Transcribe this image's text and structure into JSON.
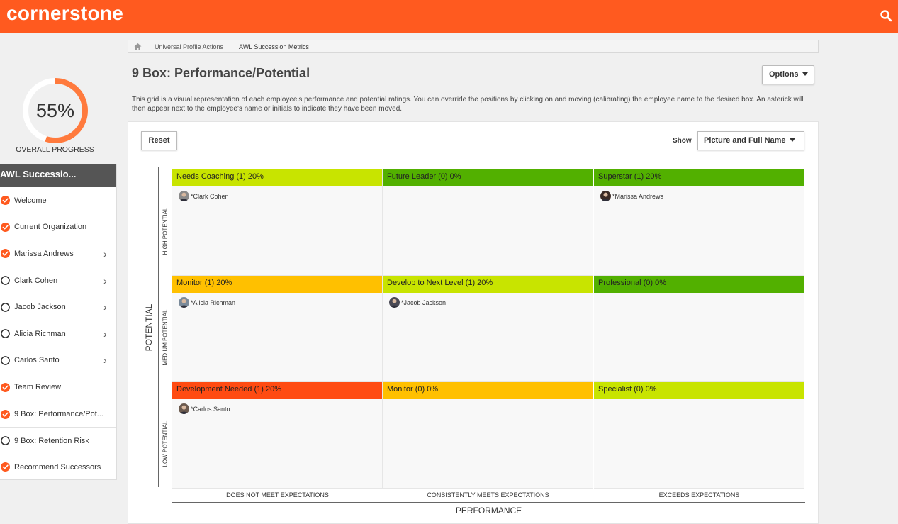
{
  "header": {
    "logo": "cornerstone"
  },
  "sidebar": {
    "progress_value": 55,
    "progress_text": "55%",
    "progress_label": "OVERALL PROGRESS",
    "menu_title": "AWL Successio...",
    "items": [
      {
        "label": "Welcome",
        "status": "complete",
        "chevron": false
      },
      {
        "label": "Current Organization",
        "status": "complete",
        "chevron": false
      },
      {
        "label": "Marissa Andrews",
        "status": "complete",
        "chevron": true
      },
      {
        "label": "Clark Cohen",
        "status": "incomplete",
        "chevron": true
      },
      {
        "label": "Jacob Jackson",
        "status": "incomplete",
        "chevron": true
      },
      {
        "label": "Alicia Richman",
        "status": "incomplete",
        "chevron": true
      },
      {
        "label": "Carlos Santo",
        "status": "incomplete",
        "chevron": true
      },
      {
        "label": "Team Review",
        "status": "complete",
        "chevron": false
      },
      {
        "label": "9 Box: Performance/Pot...",
        "status": "complete",
        "chevron": false
      },
      {
        "label": "9 Box: Retention Risk",
        "status": "incomplete",
        "chevron": false
      },
      {
        "label": "Recommend Successors",
        "status": "complete",
        "chevron": false
      }
    ]
  },
  "breadcrumb": {
    "items": [
      "Universal Profile Actions",
      "AWL Succession Metrics"
    ]
  },
  "page": {
    "title": "9 Box: Performance/Potential",
    "options_label": "Options",
    "description": "This grid is a visual representation of each employee's performance and potential ratings. You can override the positions by clicking on and moving (calibrating) the employee name to the desired box. An asterick will then appear next to the employee's name or initials to indicate they have been moved."
  },
  "grid_controls": {
    "reset_label": "Reset",
    "show_label": "Show",
    "show_value": "Picture and Full Name"
  },
  "axes": {
    "potential_title": "POTENTIAL",
    "rows": [
      "HIGH POTENTIAL",
      "MEDIUM POTENTIAL",
      "LOW POTENTIAL"
    ],
    "performance_title": "PERFORMANCE",
    "columns": [
      "DOES NOT MEET EXPECTATIONS",
      "CONSISTENTLY MEETS EXPECTATIONS",
      "EXCEEDS EXPECTATIONS"
    ]
  },
  "colors": {
    "brand": "#ff5a1f",
    "progress": "#ff7a3d",
    "lime": "#c8e400",
    "green": "#52b000",
    "amber": "#ffc000",
    "red_orange": "#ff4b12",
    "check": "#ff5a1f"
  },
  "boxes": [
    {
      "label": "Needs Coaching (1) 20%",
      "color": "#c8e400",
      "employee": "*Clark Cohen"
    },
    {
      "label": "Future Leader (0) 0%",
      "color": "#52b000",
      "employee": ""
    },
    {
      "label": "Superstar (1) 20%",
      "color": "#52b000",
      "employee": "*Marissa Andrews"
    },
    {
      "label": "Monitor (1) 20%",
      "color": "#ffc000",
      "employee": "*Alicia Richman"
    },
    {
      "label": "Develop to Next Level (1) 20%",
      "color": "#c8e400",
      "employee": "*Jacob Jackson"
    },
    {
      "label": "Professional (0) 0%",
      "color": "#52b000",
      "employee": ""
    },
    {
      "label": "Development Needed (1) 20%",
      "color": "#ff4b12",
      "employee": "*Carlos Santo"
    },
    {
      "label": "Monitor (0) 0%",
      "color": "#ffc000",
      "employee": ""
    },
    {
      "label": "Specialist (0) 0%",
      "color": "#c8e400",
      "employee": ""
    }
  ]
}
